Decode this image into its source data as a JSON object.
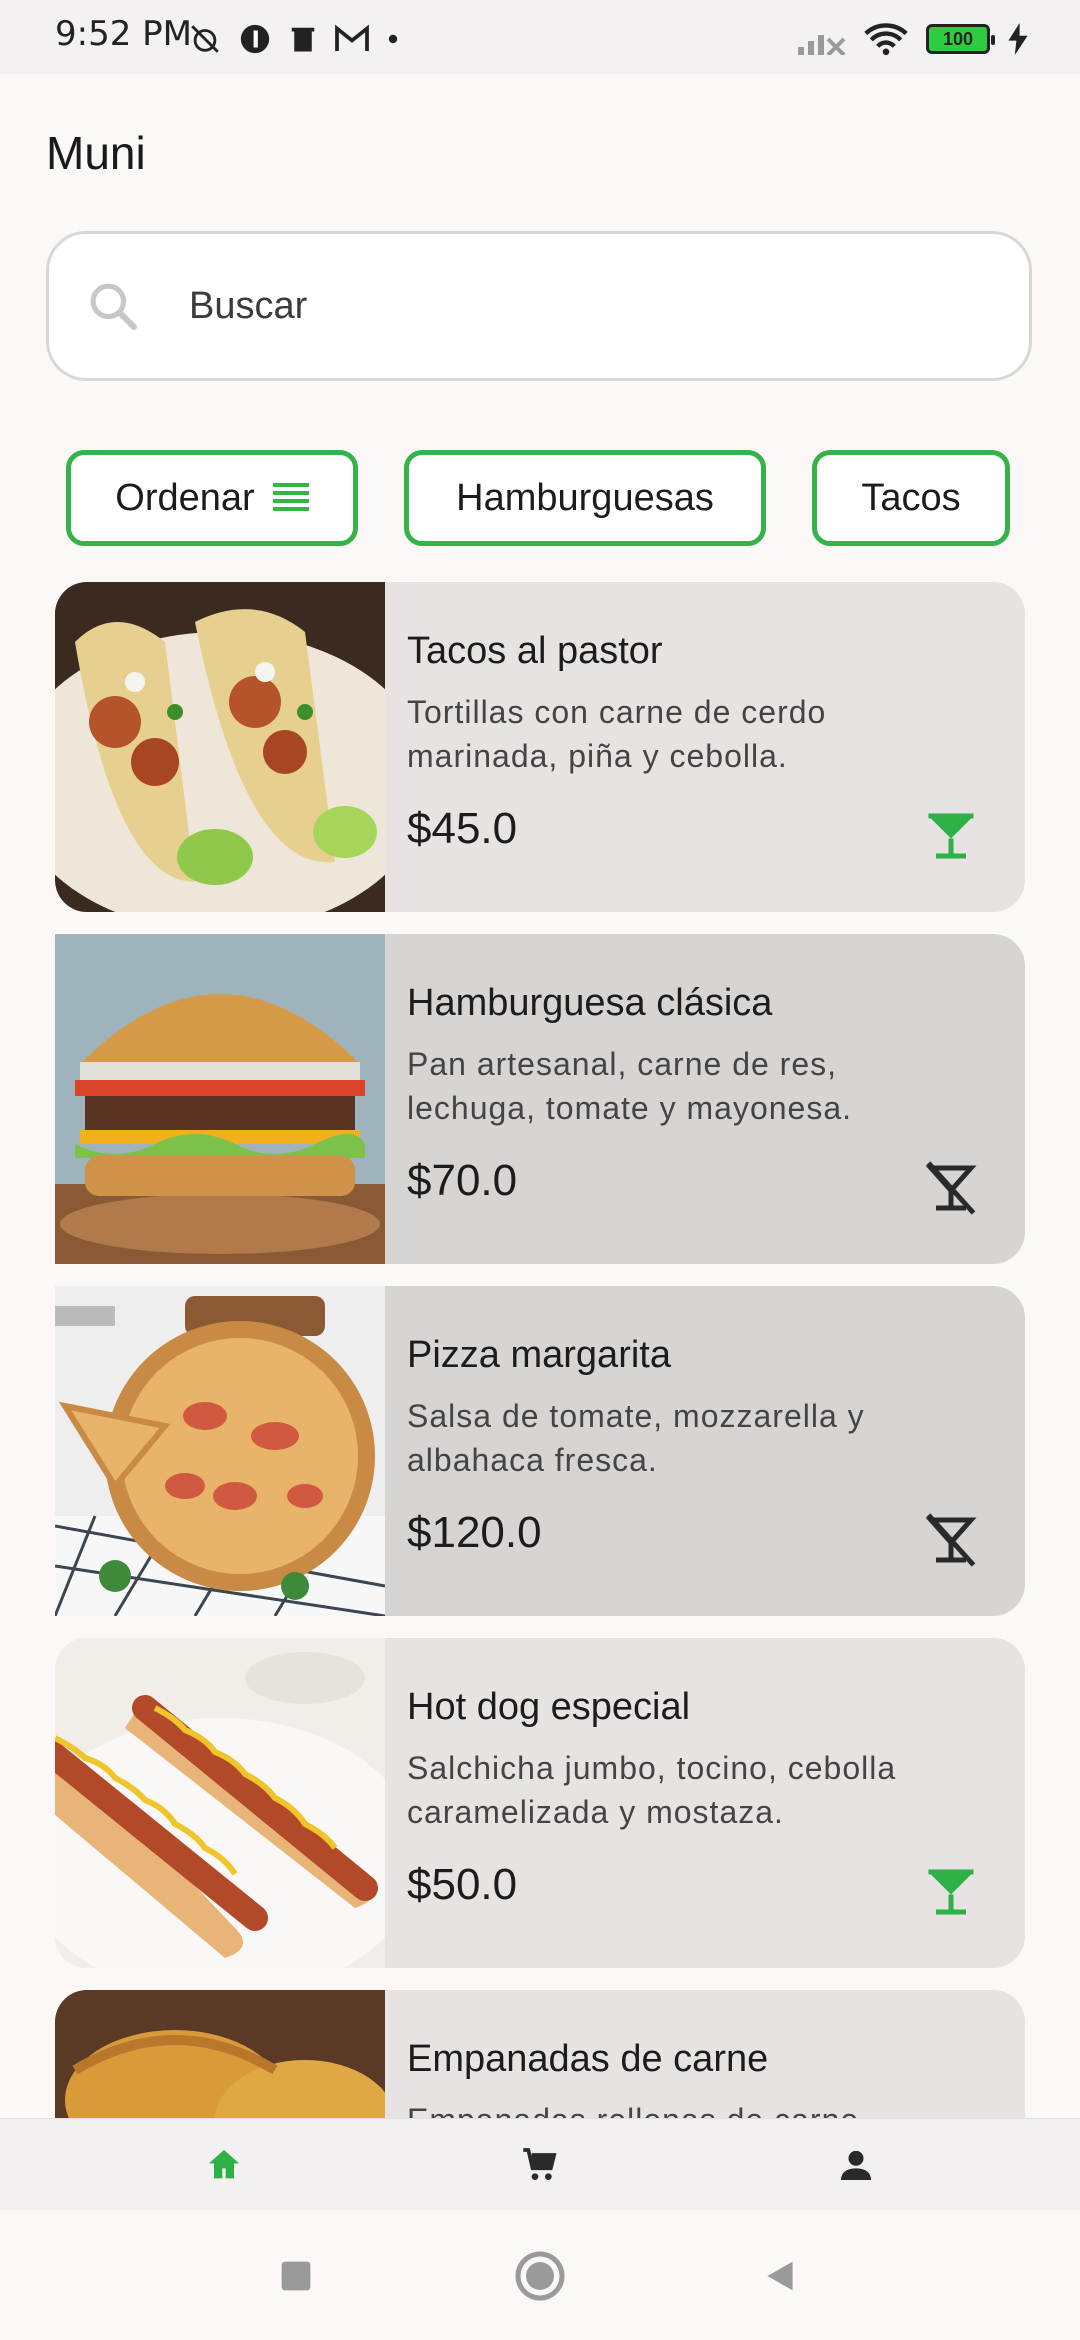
{
  "status_bar": {
    "time": "9:52 PM",
    "battery": "100"
  },
  "app": {
    "title": "Muni"
  },
  "search": {
    "placeholder": "Buscar"
  },
  "chips": {
    "sort_label": "Ordenar",
    "burgers_label": "Hamburguesas",
    "tacos_label": "Tacos"
  },
  "products": [
    {
      "name": "Tacos al pastor",
      "desc_line1": "Tortillas con carne de cerdo",
      "desc_line2": "marinada, piña y cebolla.",
      "price": "$45.0",
      "drink_icon": "cocktail-icon",
      "drink_color": "#2fb046"
    },
    {
      "name": "Hamburguesa clásica",
      "desc_line1": "Pan artesanal, carne de res,",
      "desc_line2": "lechuga, tomate y mayonesa.",
      "price": "$70.0",
      "drink_icon": "no-drink-icon",
      "drink_color": "#2a2a2a"
    },
    {
      "name": "Pizza margarita",
      "desc_line1": "Salsa de tomate, mozzarella y",
      "desc_line2": "albahaca fresca.",
      "price": "$120.0",
      "drink_icon": "no-drink-icon",
      "drink_color": "#2a2a2a"
    },
    {
      "name": "Hot dog especial",
      "desc_line1": "Salchicha jumbo, tocino, cebolla",
      "desc_line2": "caramelizada y mostaza.",
      "price": "$50.0",
      "drink_icon": "cocktail-icon",
      "drink_color": "#2fb046"
    },
    {
      "name": "Empanadas de carne",
      "desc_line1": "Empanadas rellenas de carne",
      "desc_line2": "",
      "price": "",
      "drink_icon": "",
      "drink_color": ""
    }
  ],
  "colors": {
    "accent": "#36b24a",
    "background": "#FBF8F7",
    "card": "#E7E3E3",
    "card_alt": "#D7D4D4"
  },
  "bottom_nav": {
    "items": [
      "home-icon",
      "cart-icon",
      "profile-icon"
    ],
    "active": "home-icon"
  }
}
